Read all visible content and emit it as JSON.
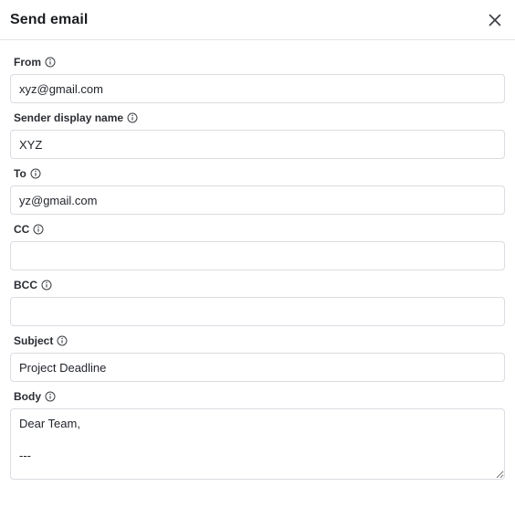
{
  "header": {
    "title": "Send email",
    "close_icon": "close-icon"
  },
  "fields": {
    "from": {
      "label": "From",
      "value": "xyz@gmail.com",
      "placeholder": ""
    },
    "sender_name": {
      "label": "Sender display name",
      "value": "XYZ",
      "placeholder": ""
    },
    "to": {
      "label": "To",
      "value": "yz@gmail.com",
      "placeholder": ""
    },
    "cc": {
      "label": "CC",
      "value": "",
      "placeholder": ""
    },
    "bcc": {
      "label": "BCC",
      "value": "",
      "placeholder": ""
    },
    "subject": {
      "label": "Subject",
      "value": "Project Deadline",
      "placeholder": ""
    },
    "body": {
      "label": "Body",
      "value": "Dear Team,\n\n---"
    }
  },
  "icons": {
    "info": "info-icon"
  },
  "colors": {
    "border": "#d9dce1",
    "divider": "#e4e6ea",
    "text": "#1f2329"
  }
}
